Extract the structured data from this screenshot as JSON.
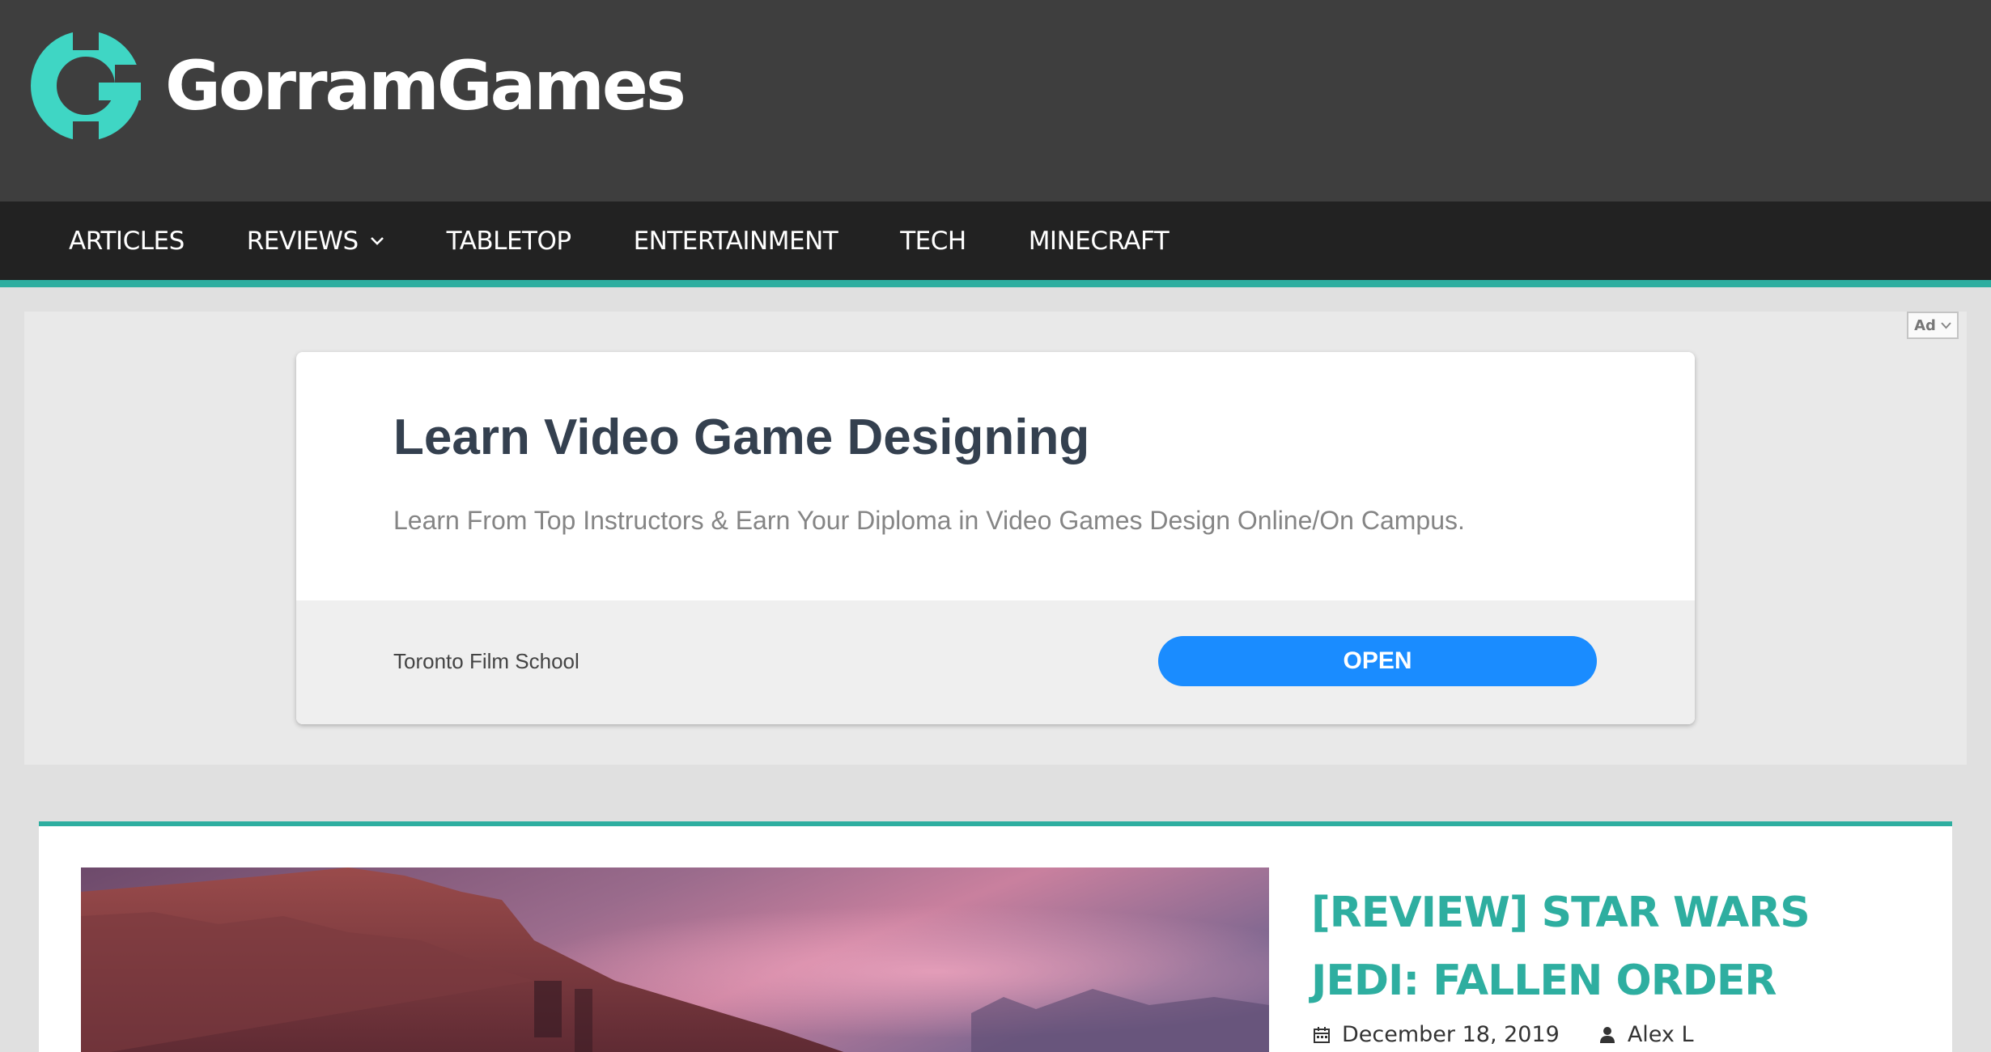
{
  "site": {
    "name": "GorramGames",
    "accent_color": "#2eaea0",
    "logo_color": "#3fd6c4"
  },
  "nav": {
    "items": [
      {
        "label": "ARTICLES"
      },
      {
        "label": "REVIEWS",
        "has_dropdown": true
      },
      {
        "label": "TABLETOP"
      },
      {
        "label": "ENTERTAINMENT"
      },
      {
        "label": "TECH"
      },
      {
        "label": "MINECRAFT"
      }
    ]
  },
  "ad": {
    "badge": "Ad",
    "title": "Learn Video Game Designing",
    "description": "Learn From Top Instructors & Earn Your Diploma in Video Games Design Online/On Campus.",
    "advertiser": "Toronto Film School",
    "cta": "OPEN",
    "cta_color": "#1a8cff"
  },
  "post": {
    "title": "[REVIEW] STAR WARS JEDI: FALLEN ORDER",
    "date": "December 18, 2019",
    "author": "Alex L",
    "date_icon": "calendar-icon",
    "author_icon": "user-icon"
  }
}
